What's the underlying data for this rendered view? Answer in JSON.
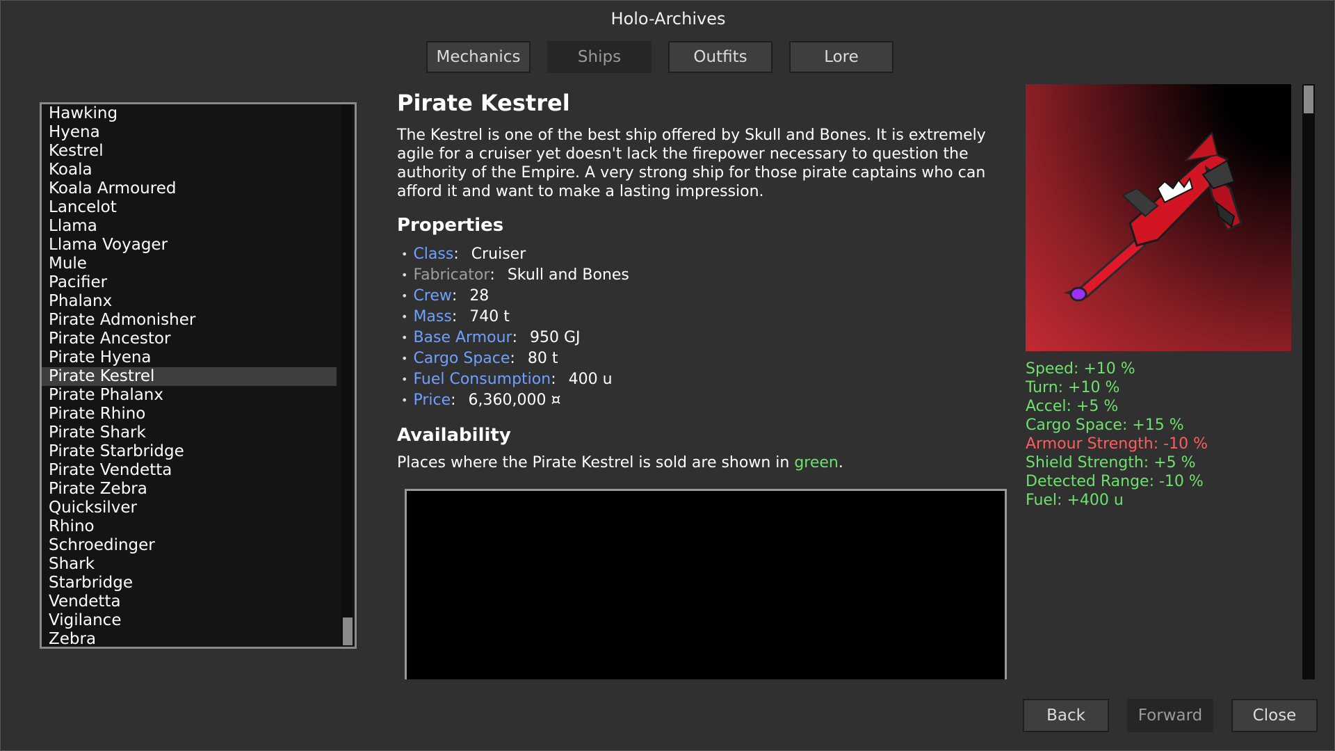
{
  "window": {
    "title": "Holo-Archives"
  },
  "tabs": [
    {
      "label": "Mechanics",
      "active": false
    },
    {
      "label": "Ships",
      "active": true
    },
    {
      "label": "Outfits",
      "active": false
    },
    {
      "label": "Lore",
      "active": false
    }
  ],
  "ship_list": {
    "items": [
      "Hawking",
      "Hyena",
      "Kestrel",
      "Koala",
      "Koala Armoured",
      "Lancelot",
      "Llama",
      "Llama Voyager",
      "Mule",
      "Pacifier",
      "Phalanx",
      "Pirate Admonisher",
      "Pirate Ancestor",
      "Pirate Hyena",
      "Pirate Kestrel",
      "Pirate Phalanx",
      "Pirate Rhino",
      "Pirate Shark",
      "Pirate Starbridge",
      "Pirate Vendetta",
      "Pirate Zebra",
      "Quicksilver",
      "Rhino",
      "Schroedinger",
      "Shark",
      "Starbridge",
      "Vendetta",
      "Vigilance",
      "Zebra"
    ],
    "selected": "Pirate Kestrel"
  },
  "ship": {
    "name": "Pirate Kestrel",
    "description": "The Kestrel is one of the best ship offered by Skull and Bones. It is extremely agile for a cruiser yet doesn't lack the firepower necessary to question the authority of the Empire. A very strong ship for those pirate captains who can afford it and want to make a lasting impression."
  },
  "properties": {
    "heading": "Properties",
    "items": [
      {
        "key": "Class",
        "value": "Cruiser",
        "link": true
      },
      {
        "key": "Fabricator",
        "value": "Skull and Bones",
        "link": false
      },
      {
        "key": "Crew",
        "value": "28",
        "link": true
      },
      {
        "key": "Mass",
        "value": "740 t",
        "link": true
      },
      {
        "key": "Base Armour",
        "value": "950 GJ",
        "link": true
      },
      {
        "key": "Cargo Space",
        "value": "80 t",
        "link": true
      },
      {
        "key": "Fuel Consumption",
        "value": "400 u",
        "link": true
      },
      {
        "key": "Price",
        "value": "6,360,000 ¤",
        "link": true
      }
    ]
  },
  "availability": {
    "heading": "Availability",
    "text_before": "Places where the Pirate Kestrel is sold are shown in ",
    "highlight": "green",
    "text_after": "."
  },
  "stats": [
    {
      "text": "Speed: +10 %",
      "positive": true
    },
    {
      "text": "Turn: +10 %",
      "positive": true
    },
    {
      "text": "Accel: +5 %",
      "positive": true
    },
    {
      "text": "Cargo Space: +15 %",
      "positive": true
    },
    {
      "text": "Armour Strength: -10 %",
      "positive": false
    },
    {
      "text": "Shield Strength: +5 %",
      "positive": true
    },
    {
      "text": "Detected Range: -10 %",
      "positive": true
    },
    {
      "text": "Fuel: +400 u",
      "positive": true
    }
  ],
  "buttons": {
    "back": "Back",
    "forward": "Forward",
    "close": "Close"
  },
  "colors": {
    "link": "#6fa0ff",
    "positive": "#6ee06e",
    "negative": "#ff5c5c",
    "panel": "#303030"
  }
}
